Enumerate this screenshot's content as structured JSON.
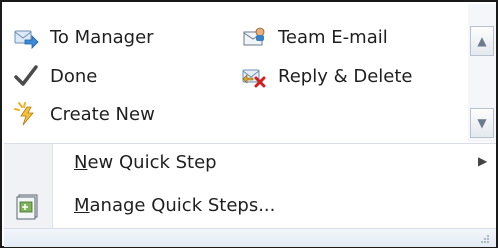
{
  "quick_steps": {
    "items": [
      {
        "label": "To Manager",
        "icon": "forward-arrow-icon"
      },
      {
        "label": "Team E-mail",
        "icon": "team-email-icon"
      },
      {
        "label": "Done",
        "icon": "checkmark-icon"
      },
      {
        "label": "Reply & Delete",
        "icon": "reply-delete-icon"
      },
      {
        "label": "Create New",
        "icon": "lightning-new-icon"
      }
    ]
  },
  "menu": {
    "new_quick_step_prefix": "",
    "new_quick_step_underline": "N",
    "new_quick_step_rest": "ew Quick Step",
    "manage_underline": "M",
    "manage_rest": "anage Quick Steps..."
  }
}
